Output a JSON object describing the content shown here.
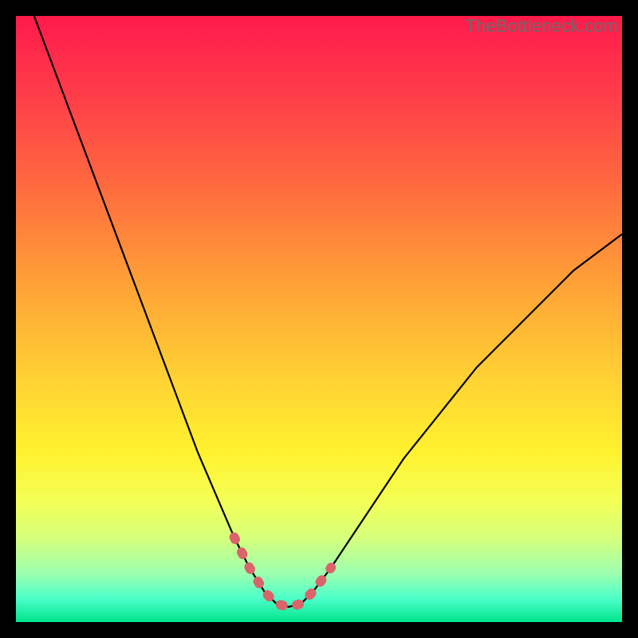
{
  "watermark": "TheBottleneck.com",
  "colors": {
    "frame": "#000000",
    "curve": "#000000",
    "highlight": "#d9646b",
    "gradient_stops": [
      {
        "offset": 0.0,
        "color": "#ff1a4b"
      },
      {
        "offset": 0.12,
        "color": "#ff3a4a"
      },
      {
        "offset": 0.28,
        "color": "#ff6a3f"
      },
      {
        "offset": 0.45,
        "color": "#ffa436"
      },
      {
        "offset": 0.6,
        "color": "#ffd233"
      },
      {
        "offset": 0.72,
        "color": "#fff22e"
      },
      {
        "offset": 0.8,
        "color": "#f4ff55"
      },
      {
        "offset": 0.86,
        "color": "#d6ff7a"
      },
      {
        "offset": 0.92,
        "color": "#9dffb0"
      },
      {
        "offset": 0.96,
        "color": "#4effc9"
      },
      {
        "offset": 1.0,
        "color": "#00e58e"
      }
    ]
  },
  "chart_data": {
    "type": "line",
    "title": "",
    "xlabel": "",
    "ylabel": "",
    "xlim": [
      0,
      100
    ],
    "ylim": [
      0,
      100
    ],
    "series": [
      {
        "name": "bottleneck-curve",
        "x": [
          3,
          6,
          9,
          12,
          15,
          18,
          21,
          24,
          27,
          30,
          33,
          36,
          38.5,
          41,
          43,
          45,
          47,
          49,
          52,
          56,
          60,
          64,
          68,
          72,
          76,
          80,
          84,
          88,
          92,
          96,
          100
        ],
        "y": [
          100,
          92,
          84,
          76,
          68,
          60,
          52,
          44,
          36,
          28,
          21,
          14,
          9,
          5,
          3,
          2.5,
          3,
          5,
          9,
          15,
          21,
          27,
          32,
          37,
          42,
          46,
          50,
          54,
          58,
          61,
          64
        ]
      }
    ],
    "highlight": {
      "x": [
        36,
        38.5,
        41,
        43,
        45,
        47,
        49,
        52
      ],
      "y": [
        14,
        9,
        5,
        3,
        2.5,
        3,
        5,
        9
      ]
    }
  }
}
